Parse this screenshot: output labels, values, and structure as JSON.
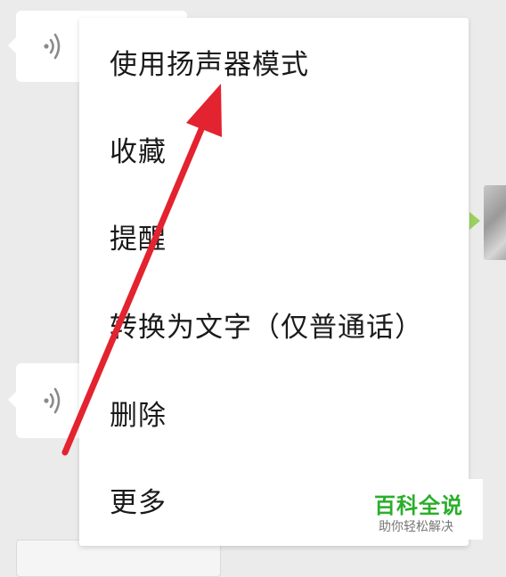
{
  "menu": {
    "items": [
      {
        "label": "使用扬声器模式"
      },
      {
        "label": "收藏"
      },
      {
        "label": "提醒"
      },
      {
        "label": "转换为文字（仅普通话）"
      },
      {
        "label": "删除"
      },
      {
        "label": "更多"
      }
    ]
  },
  "watermark": {
    "title": "百科全说",
    "subtitle": "助你轻松解决"
  },
  "icons": {
    "voice": "voice-message-icon",
    "arrow": "annotation-arrow-icon"
  },
  "colors": {
    "chat_background": "#ebebeb",
    "menu_background": "#ffffff",
    "menu_text": "#1a1a1a",
    "arrow": "#e3232f",
    "watermark_green": "#2aae2a",
    "sent_bubble_green": "#9bd15f"
  }
}
